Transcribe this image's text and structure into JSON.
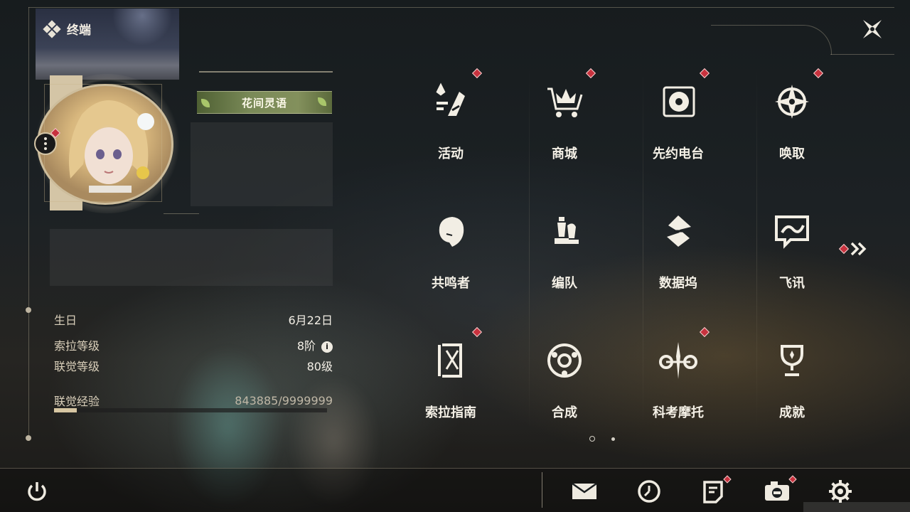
{
  "header": {
    "title": "终端",
    "icon": "diamond-cluster-icon"
  },
  "profile": {
    "title_badge": "花间灵语",
    "stats": [
      {
        "label": "生日",
        "value": "6月22日"
      },
      {
        "label": "索拉等级",
        "value": "8阶"
      },
      {
        "label": "联觉等级",
        "value": "80级"
      }
    ],
    "exp": {
      "label": "联觉经验",
      "value": "843885/9999999",
      "current": 843885,
      "max": 9999999
    }
  },
  "menu": [
    {
      "label": "活动",
      "icon": "sparkle-event-icon",
      "badge": true
    },
    {
      "label": "商城",
      "icon": "crown-cart-icon",
      "badge": true
    },
    {
      "label": "先约电台",
      "icon": "vinyl-record-icon",
      "badge": true
    },
    {
      "label": "唤取",
      "icon": "compass-star-icon",
      "badge": true
    },
    {
      "label": "共鸣者",
      "icon": "character-head-icon",
      "badge": false
    },
    {
      "label": "编队",
      "icon": "chess-pieces-icon",
      "badge": false
    },
    {
      "label": "数据坞",
      "icon": "data-dock-icon",
      "badge": false
    },
    {
      "label": "飞讯",
      "icon": "chat-bubble-icon",
      "badge": false
    },
    {
      "label": "索拉指南",
      "icon": "guide-book-icon",
      "badge": true
    },
    {
      "label": "合成",
      "icon": "synthesis-ring-icon",
      "badge": false
    },
    {
      "label": "科考摩托",
      "icon": "motorbike-icon",
      "badge": true
    },
    {
      "label": "成就",
      "icon": "trophy-icon",
      "badge": false
    }
  ],
  "pager": {
    "current": 1,
    "total": 2
  },
  "bottom_bar": [
    {
      "name": "mail",
      "icon": "mail-icon",
      "badge": false
    },
    {
      "name": "clock",
      "icon": "clock-icon",
      "badge": false
    },
    {
      "name": "notice",
      "icon": "notice-icon",
      "badge": true
    },
    {
      "name": "camera",
      "icon": "camera-icon",
      "badge": true
    },
    {
      "name": "settings",
      "icon": "gear-icon",
      "badge": false
    }
  ],
  "colors": {
    "badge_red": "#c8323e",
    "text_light": "#f4f0e6",
    "accent_gold": "#d7c6a2",
    "title_badge_green": "#7a8a58"
  }
}
